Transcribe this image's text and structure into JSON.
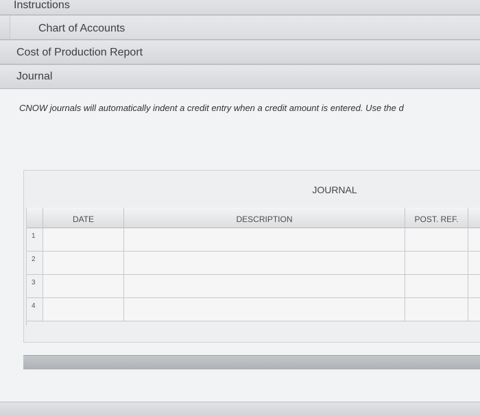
{
  "tabs": {
    "instructions": "Instructions",
    "chart_of_accounts": "Chart of Accounts",
    "cost_report": "Cost of Production Report",
    "journal": "Journal"
  },
  "instruction_text": "CNOW journals will automatically indent a credit entry when a credit amount is entered. Use the d",
  "journal": {
    "title": "JOURNAL",
    "columns": {
      "date": "DATE",
      "description": "DESCRIPTION",
      "post_ref": "POST. REF."
    },
    "rows": [
      "1",
      "2",
      "3",
      "4"
    ]
  }
}
